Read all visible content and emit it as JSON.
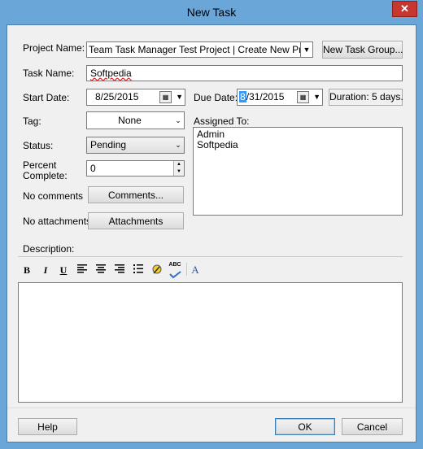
{
  "window": {
    "title": "New Task",
    "close_glyph": "✕"
  },
  "project": {
    "label": "Project Name:",
    "value": "Team Task Manager Test Project | Create New Project",
    "new_group_button": "New Task Group..."
  },
  "task": {
    "label": "Task Name:",
    "value": "Softpedia"
  },
  "start": {
    "label": "Start Date:",
    "value": "8/25/2015"
  },
  "due": {
    "label": "Due Date:",
    "value_highlight": "8",
    "value_rest": "/31/2015"
  },
  "duration": {
    "label": "Duration: 5 days."
  },
  "tag": {
    "label": "Tag:",
    "value": "None"
  },
  "status": {
    "label": "Status:",
    "value": "Pending"
  },
  "percent": {
    "label_line1": "Percent",
    "label_line2": "Complete:",
    "value": "0"
  },
  "comments": {
    "label": "No comments",
    "button": "Comments..."
  },
  "attachments": {
    "label": "No attachments",
    "button": "Attachments"
  },
  "assigned": {
    "label": "Assigned To:",
    "items": [
      "Admin",
      "Softpedia"
    ]
  },
  "description": {
    "label": "Description:"
  },
  "toolbar": {
    "bold": "B",
    "italic": "I",
    "underline": "U",
    "spell_text": "ABC",
    "font": "A"
  },
  "footer": {
    "help": "Help",
    "ok": "OK",
    "cancel": "Cancel"
  },
  "colors": {
    "titlebar": "#6aa6d8",
    "close": "#c7372f",
    "highlight": "#3399ff"
  }
}
